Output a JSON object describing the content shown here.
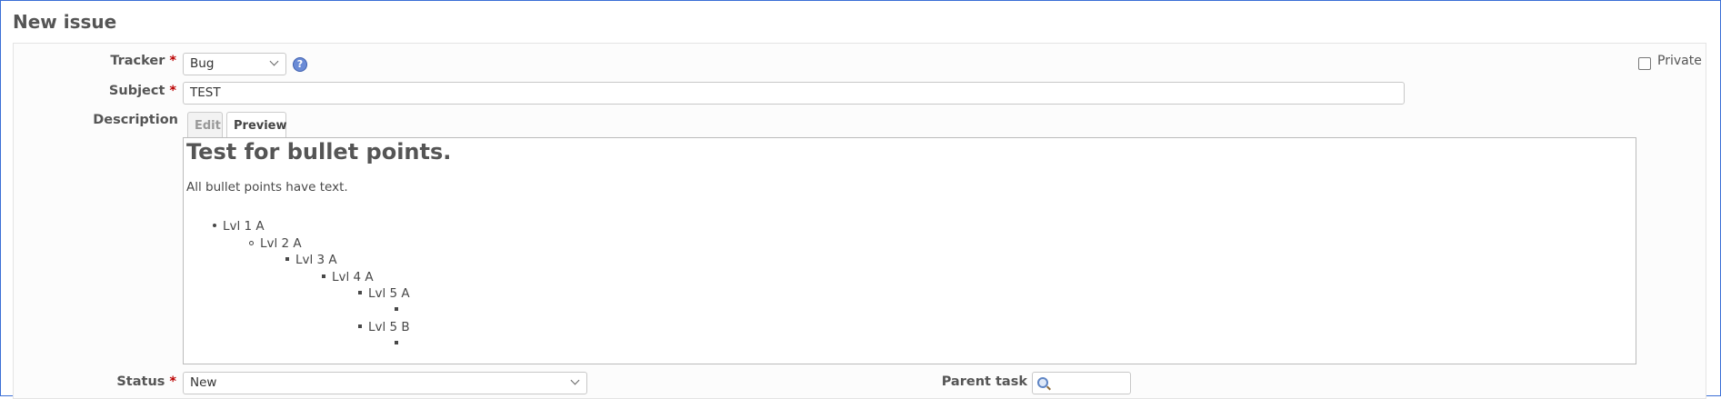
{
  "page": {
    "title": "New issue"
  },
  "form": {
    "tracker": {
      "label": "Tracker",
      "required_mark": "*",
      "value": "Bug",
      "help_icon": "help-icon",
      "help_glyph": "?"
    },
    "private": {
      "label": "Private",
      "checked": false
    },
    "subject": {
      "label": "Subject",
      "required_mark": "*",
      "value": "TEST"
    },
    "description": {
      "label": "Description",
      "tabs": [
        {
          "label": "Edit",
          "active": false
        },
        {
          "label": "Preview",
          "active": true
        }
      ],
      "preview": {
        "heading": "Test for bullet points.",
        "paragraph": "All bullet points have text.",
        "bullets": [
          {
            "text": "Lvl 1 A",
            "marker": "disc"
          },
          {
            "text": "Lvl 2 A",
            "marker": "circle"
          },
          {
            "text": "Lvl 3 A",
            "marker": "square"
          },
          {
            "text": "Lvl 4 A",
            "marker": "square"
          },
          {
            "text": "Lvl 5 A",
            "marker": "square"
          },
          {
            "text": "",
            "marker": "square"
          },
          {
            "text": "Lvl 5 B",
            "marker": "square"
          },
          {
            "text": "",
            "marker": "square"
          }
        ]
      }
    },
    "status": {
      "label": "Status",
      "required_mark": "*",
      "value": "New"
    },
    "parent_task": {
      "label": "Parent task",
      "value": "",
      "icon": "search-icon"
    }
  }
}
